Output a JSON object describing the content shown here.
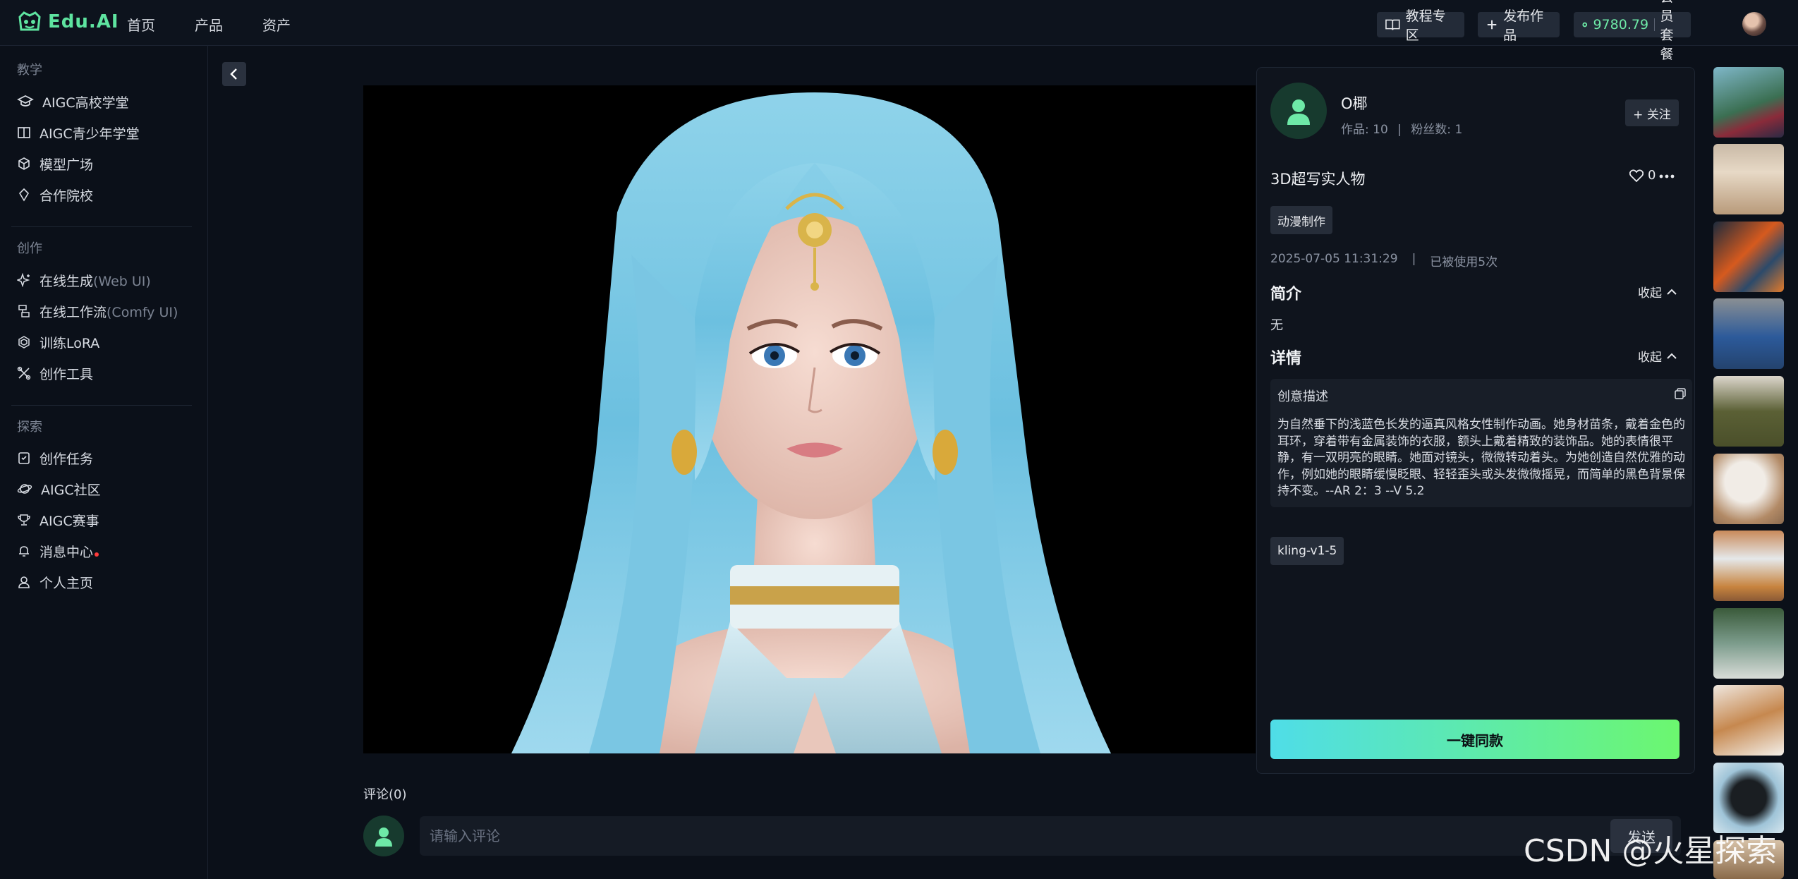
{
  "topbar": {
    "logo_text": "Edu.AI",
    "nav": [
      "首页",
      "产品",
      "资产"
    ],
    "tutorial_label": "教程专区",
    "publish_label": "发布作品",
    "balance": "9780.79",
    "membership_label": "会员套餐"
  },
  "sidebar": {
    "sections": [
      {
        "title": "教学",
        "items": [
          {
            "label": "AIGC高校学堂",
            "icon": "graduation-cap-icon"
          },
          {
            "label": "AIGC青少年学堂",
            "icon": "book-icon"
          },
          {
            "label": "模型广场",
            "icon": "cube-icon"
          },
          {
            "label": "合作院校",
            "icon": "gem-icon"
          }
        ]
      },
      {
        "title": "创作",
        "items": [
          {
            "label": "在线生成",
            "suffix": "(Web UI)",
            "icon": "sparkle-icon"
          },
          {
            "label": "在线工作流",
            "suffix": "(Comfy UI)",
            "icon": "workflow-icon"
          },
          {
            "label": "训练LoRA",
            "icon": "layers-icon"
          },
          {
            "label": "创作工具",
            "icon": "tools-icon"
          }
        ]
      },
      {
        "title": "探索",
        "items": [
          {
            "label": "创作任务",
            "icon": "clipboard-icon"
          },
          {
            "label": "AIGC社区",
            "icon": "planet-icon"
          },
          {
            "label": "AIGC赛事",
            "icon": "trophy-icon"
          },
          {
            "label": "消息中心",
            "icon": "bell-icon",
            "unread": true
          },
          {
            "label": "个人主页",
            "icon": "user-icon"
          }
        ]
      }
    ]
  },
  "author": {
    "name": "O椰",
    "works_label": "作品: 10",
    "fans_label": "粉丝数: 1",
    "follow_label": "+ 关注"
  },
  "work": {
    "title": "3D超写实人物",
    "likes": "0",
    "tag": "动漫制作",
    "date": "2025-07-05 11:31:29",
    "separator": "|",
    "usage": "已被使用5次",
    "intro_heading": "简介",
    "intro_text": "无",
    "detail_heading": "详情",
    "collapse_label": "收起",
    "prompt_label": "创意描述",
    "prompt_text": "为自然垂下的浅蓝色长发的逼真风格女性制作动画。她身材苗条，戴着金色的耳环，穿着带有金属装饰的衣服，额头上戴着精致的装饰品。她的表情很平静，有一双明亮的眼睛。她面对镜头，微微转动着头。为她创造自然优雅的动作，例如她的眼睛缓慢眨眼、轻轻歪头或头发微微摇晃，而简单的黑色背景保持不变。--AR 2：3 --V 5.2",
    "model_tag": "kling-v1-5",
    "cta_label": "一键同款"
  },
  "comments": {
    "title": "评论(0)",
    "placeholder": "请输入评论",
    "send_label": "发送"
  },
  "watermark": "CSDN @火星探索",
  "colors": {
    "accent_green": "#5ee4a0",
    "cta_gradient_start": "#4fdde8",
    "cta_gradient_end": "#6cf76f",
    "background": "#0b1019"
  }
}
